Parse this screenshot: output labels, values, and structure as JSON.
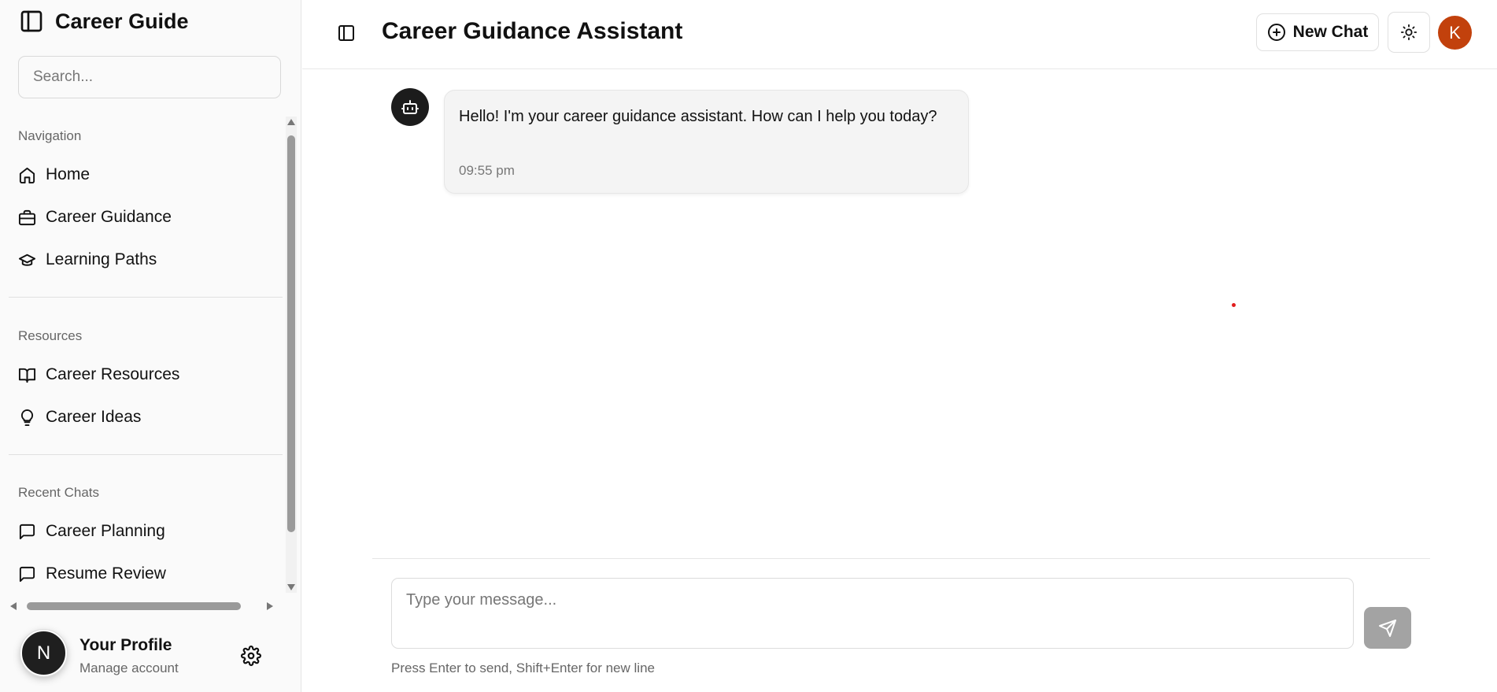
{
  "sidebar": {
    "brand_title": "Career Guide",
    "search_placeholder": "Search...",
    "sections": [
      {
        "label": "Navigation",
        "items": [
          {
            "label": "Home",
            "icon": "home-icon"
          },
          {
            "label": "Career Guidance",
            "icon": "briefcase-icon"
          },
          {
            "label": "Learning Paths",
            "icon": "graduation-cap-icon"
          }
        ]
      },
      {
        "label": "Resources",
        "items": [
          {
            "label": "Career Resources",
            "icon": "book-open-icon"
          },
          {
            "label": "Career Ideas",
            "icon": "lightbulb-icon"
          }
        ]
      },
      {
        "label": "Recent Chats",
        "items": [
          {
            "label": "Career Planning",
            "icon": "message-square-icon"
          },
          {
            "label": "Resume Review",
            "icon": "message-square-icon"
          }
        ]
      }
    ],
    "profile": {
      "initial": "N",
      "name": "Your Profile",
      "subtitle": "Manage account"
    }
  },
  "header": {
    "title": "Career Guidance Assistant",
    "new_chat_label": "New Chat",
    "user_initial": "K"
  },
  "chat": {
    "messages": [
      {
        "sender": "assistant",
        "text": "Hello! I'm your career guidance assistant. How can I help you today?",
        "time": "09:55 pm"
      }
    ]
  },
  "composer": {
    "placeholder": "Type your message...",
    "hint": "Press Enter to send, Shift+Enter for new line"
  },
  "colors": {
    "user_avatar": "#c2410c",
    "send_button": "#a3a3a3",
    "bot_avatar": "#1c1c1c"
  }
}
